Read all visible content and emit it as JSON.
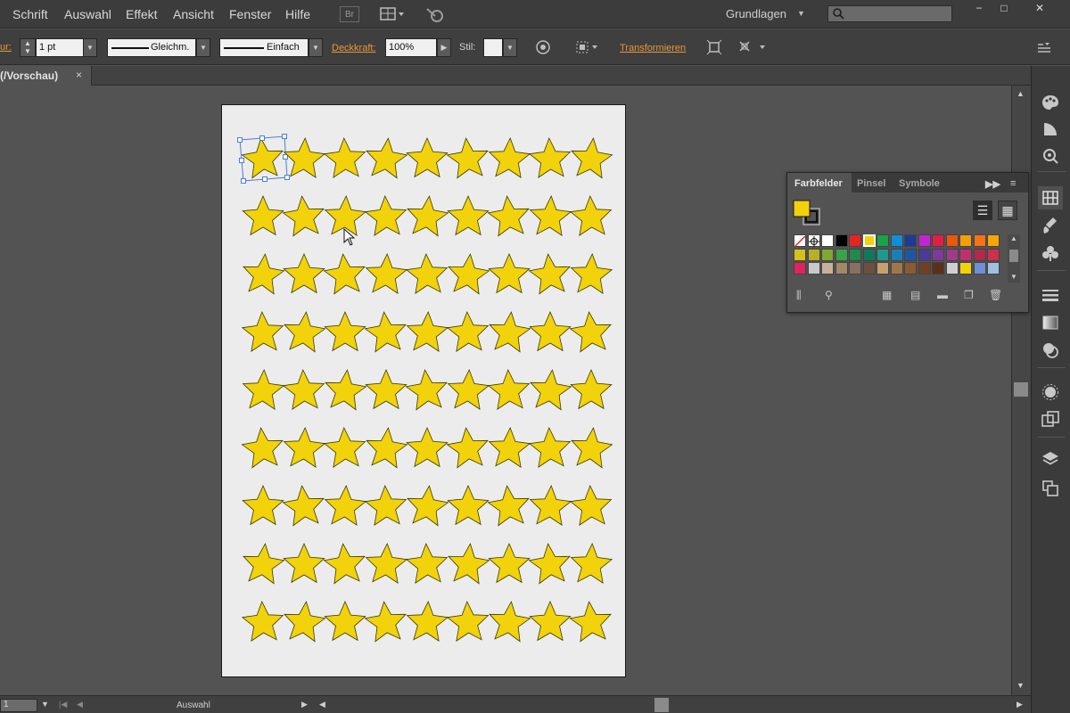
{
  "menu": {
    "items": [
      "Schrift",
      "Auswahl",
      "Effekt",
      "Ansicht",
      "Fenster",
      "Hilfe"
    ],
    "bridge_label": "Br",
    "workspace": "Grundlagen",
    "search_placeholder": "",
    "window_controls": [
      "−",
      "□",
      "✕"
    ]
  },
  "control_bar": {
    "stroke_label": "ur:",
    "stroke_value": "1 pt",
    "profile_label": "Gleichm.",
    "brush_label": "Einfach",
    "opacity_label": "Deckkraft:",
    "opacity_value": "100%",
    "style_label": "Stil:",
    "transform_label": "Transformieren"
  },
  "document_tab": {
    "title": "(/Vorschau)",
    "close": "×"
  },
  "artboard": {
    "rows": 9,
    "cols": 9,
    "star_fill": "#f2d20a",
    "star_stroke": "#3a3a00",
    "selected_index": 0,
    "selection_color": "#4b7bd8"
  },
  "status_bar": {
    "zoom": "1",
    "tool": "Auswahl"
  },
  "swatches_panel": {
    "tabs": [
      "Farbfelder",
      "Pinsel",
      "Symbole"
    ],
    "active_tab": "Farbfelder",
    "fill_color": "#f2d20a",
    "swatch_rows": [
      [
        "none",
        "registration",
        "#ffffff",
        "#000000",
        "#e8241f",
        "#f2d20a",
        "#16a34a",
        "#0f8fd6",
        "#1f3a93",
        "#c026d3",
        "#e11d48",
        "#ea580c",
        "#f59e0b",
        "#f97316",
        "#f7a600"
      ],
      [
        "#d4c21a",
        "#b8b020",
        "#7da832",
        "#3aa34a",
        "#1e8a4c",
        "#10795a",
        "#1d9a8f",
        "#1a7fb8",
        "#2055a4",
        "#4b3a9a",
        "#7d3a9a",
        "#a03a8a",
        "#c03070",
        "#b02a4a",
        "#d0304a"
      ],
      [
        "#e0245e",
        "#c9c9c9",
        "#c7b299",
        "#a08a6a",
        "#8a7060",
        "#6a5040",
        "#c8a070",
        "#a07848",
        "#8a5a30",
        "#704020",
        "#5a3018",
        "#d0d0d0",
        "#f2d20a",
        "#6f8fd6",
        "#a0c0e0"
      ]
    ]
  },
  "dock": {
    "icons": [
      "color-palette-icon",
      "color-guide-icon",
      "symbols-link-icon",
      "swatches-grid-icon",
      "brushes-icon",
      "symbols-club-icon",
      "stroke-lines-icon",
      "gradient-icon",
      "transparency-icon",
      "appearance-icon",
      "graphic-styles-icon",
      "layers-icon",
      "artboards-icon"
    ]
  }
}
